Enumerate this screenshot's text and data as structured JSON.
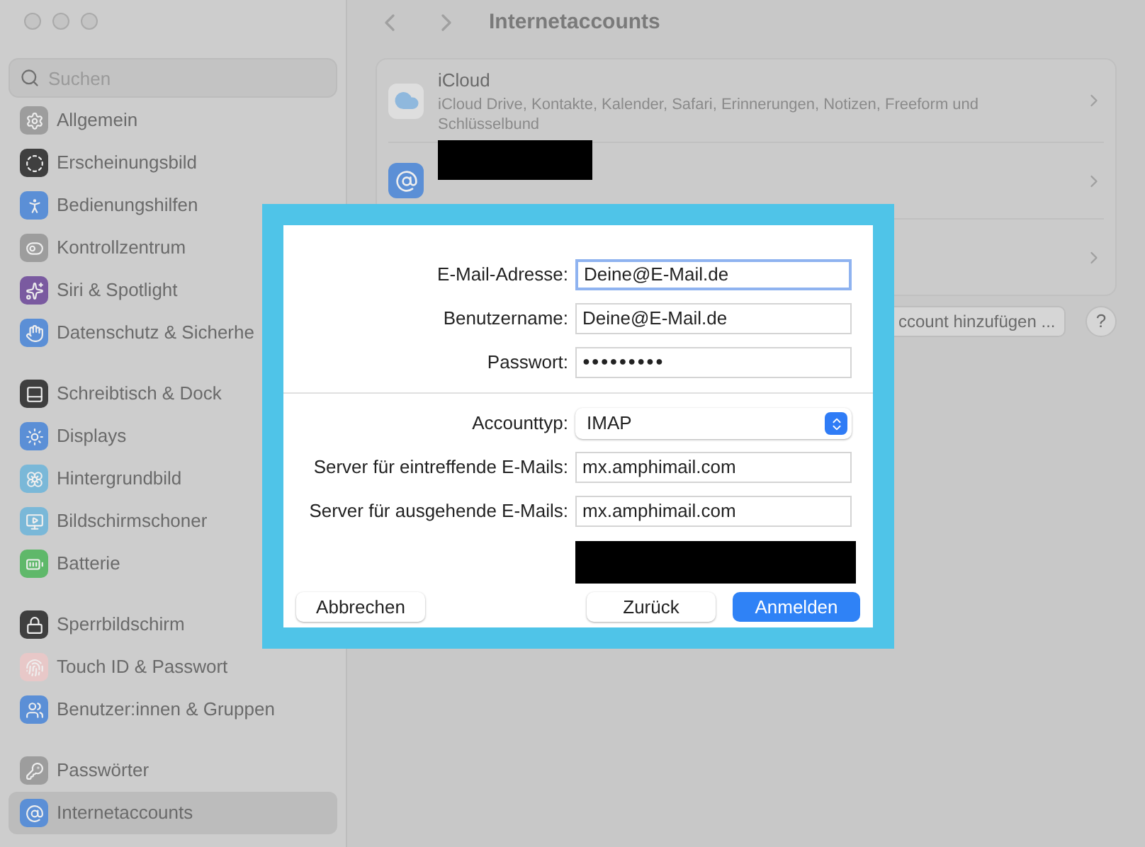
{
  "sidebar": {
    "search": {
      "placeholder": "Suchen"
    },
    "groups": [
      {
        "items": [
          {
            "label": "Allgemein",
            "selected": false
          },
          {
            "label": "Erscheinungsbild",
            "selected": false
          },
          {
            "label": "Bedienungshilfen",
            "selected": false
          },
          {
            "label": "Kontrollzentrum",
            "selected": false
          },
          {
            "label": "Siri & Spotlight",
            "selected": false
          },
          {
            "label": "Datenschutz & Sicherhe",
            "selected": false
          }
        ]
      },
      {
        "items": [
          {
            "label": "Schreibtisch & Dock",
            "selected": false
          },
          {
            "label": "Displays",
            "selected": false
          },
          {
            "label": "Hintergrundbild",
            "selected": false
          },
          {
            "label": "Bildschirmschoner",
            "selected": false
          },
          {
            "label": "Batterie",
            "selected": false
          }
        ]
      },
      {
        "items": [
          {
            "label": "Sperrbildschirm",
            "selected": false
          },
          {
            "label": "Touch ID & Passwort",
            "selected": false
          },
          {
            "label": "Benutzer:innen & Gruppen",
            "selected": false
          }
        ]
      },
      {
        "items": [
          {
            "label": "Passwörter",
            "selected": false
          },
          {
            "label": "Internetaccounts",
            "selected": true
          }
        ]
      }
    ]
  },
  "toolbar": {
    "title": "Internetaccounts"
  },
  "accounts": [
    {
      "kind": "icloud",
      "name": "iCloud",
      "detail": "iCloud Drive, Kontakte, Kalender, Safari, Erinnerungen, Notizen, Freeform und Schlüsselbund"
    },
    {
      "kind": "redacted"
    },
    {
      "kind": "covered"
    }
  ],
  "add_account_button": "ccount hinzufügen ...",
  "help_button": "?",
  "dialog": {
    "fields": [
      {
        "kind": "text",
        "label": "E-Mail-Adresse:",
        "value": "Deine@E-Mail.de",
        "focused": true
      },
      {
        "kind": "text",
        "label": "Benutzername:",
        "value": "Deine@E-Mail.de",
        "focused": false
      },
      {
        "kind": "password",
        "label": "Passwort:",
        "value": "●●●●●●●●●",
        "focused": false
      }
    ],
    "server_fields": [
      {
        "kind": "popup",
        "label": "Accounttyp:",
        "value": "IMAP",
        "focused": false
      },
      {
        "kind": "text",
        "label": "Server für eintreffende E-Mails:",
        "value": "mx.amphimail.com",
        "focused": false
      },
      {
        "kind": "text",
        "label": "Server für ausgehende E-Mails:",
        "value": "mx.amphimail.com",
        "focused": false
      }
    ],
    "buttons": [
      {
        "kind": "plain",
        "label": "Abbrechen"
      },
      {
        "kind": "plain",
        "label": "Zurück"
      },
      {
        "kind": "primary",
        "label": "Anmelden"
      }
    ]
  }
}
